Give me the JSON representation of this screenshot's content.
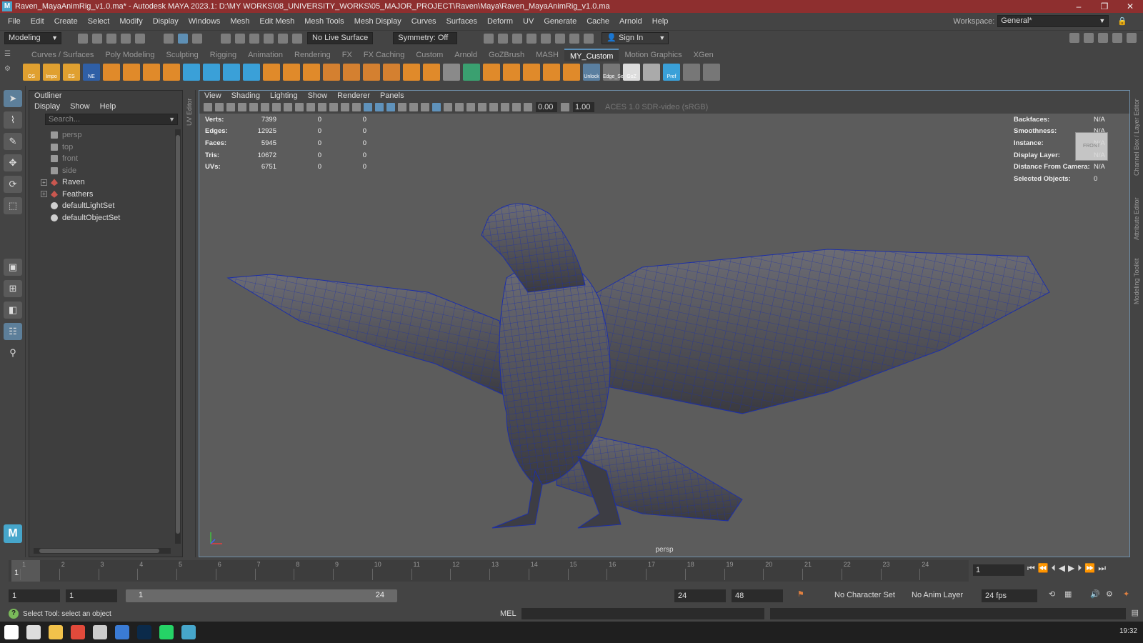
{
  "window": {
    "title": "Raven_MayaAnimRig_v1.0.ma* - Autodesk MAYA 2023.1: D:\\MY WORKS\\08_UNIVERSITY_WORKS\\05_MAJOR_PROJECT\\Raven\\Maya\\Raven_MayaAnimRig_v1.0.ma",
    "controls": [
      "–",
      "❐",
      "✕"
    ]
  },
  "menubar": {
    "items": [
      "File",
      "Edit",
      "Create",
      "Select",
      "Modify",
      "Display",
      "Windows",
      "Mesh",
      "Edit Mesh",
      "Mesh Tools",
      "Mesh Display",
      "Curves",
      "Surfaces",
      "Deform",
      "UV",
      "Generate",
      "Cache",
      "Arnold",
      "Help"
    ],
    "workspace_label": "Workspace:",
    "workspace_value": "General*"
  },
  "statusline": {
    "mode": "Modeling",
    "live_surface": "No Live Surface",
    "symmetry": "Symmetry: Off",
    "sign_in": "Sign In"
  },
  "shelf": {
    "tabs": [
      "Curves / Surfaces",
      "Poly Modeling",
      "Sculpting",
      "Rigging",
      "Animation",
      "Rendering",
      "FX",
      "FX Caching",
      "Custom",
      "Arnold",
      "GoZBrush",
      "MASH",
      "MY_Custom",
      "Motion Graphics",
      "XGen"
    ],
    "active_tab": "MY_Custom",
    "buttons": [
      {
        "label": "OS",
        "color": "#e0a030"
      },
      {
        "label": "Impo",
        "color": "#e0a030"
      },
      {
        "label": "ES",
        "color": "#e0a030"
      },
      {
        "label": "NE",
        "color": "#2f5fa6"
      },
      {
        "label": "",
        "color": "#e08a2a"
      },
      {
        "label": "",
        "color": "#e08a2a"
      },
      {
        "label": "",
        "color": "#e08a2a"
      },
      {
        "label": "",
        "color": "#e08a2a"
      },
      {
        "label": "",
        "color": "#3aa0d8"
      },
      {
        "label": "",
        "color": "#3aa0d8"
      },
      {
        "label": "",
        "color": "#3aa0d8"
      },
      {
        "label": "",
        "color": "#3aa0d8"
      },
      {
        "label": "",
        "color": "#e08a2a"
      },
      {
        "label": "",
        "color": "#e08a2a"
      },
      {
        "label": "",
        "color": "#e08a2a"
      },
      {
        "label": "",
        "color": "#d48030"
      },
      {
        "label": "",
        "color": "#d48030"
      },
      {
        "label": "",
        "color": "#d48030"
      },
      {
        "label": "",
        "color": "#d48030"
      },
      {
        "label": "",
        "color": "#e08a2a"
      },
      {
        "label": "",
        "color": "#e08a2a"
      },
      {
        "label": "",
        "color": "#8a8a8a"
      },
      {
        "label": "",
        "color": "#3aa070"
      },
      {
        "label": "",
        "color": "#e08a2a"
      },
      {
        "label": "",
        "color": "#e08a2a"
      },
      {
        "label": "",
        "color": "#e08a2a"
      },
      {
        "label": "",
        "color": "#e08a2a"
      },
      {
        "label": "",
        "color": "#e08a2a"
      },
      {
        "label": "Unlock",
        "color": "#5a7fa0"
      },
      {
        "label": "Edge_Se",
        "color": "#777"
      },
      {
        "label": "GoZ",
        "color": "#ddd"
      },
      {
        "label": "",
        "color": "#aaa"
      },
      {
        "label": "Pref",
        "color": "#3aa0d8"
      },
      {
        "label": "",
        "color": "#777"
      },
      {
        "label": "",
        "color": "#777"
      }
    ]
  },
  "outliner": {
    "title": "Outliner",
    "menu": [
      "Display",
      "Show",
      "Help"
    ],
    "search_placeholder": "Search...",
    "items": [
      {
        "name": "persp",
        "type": "camera"
      },
      {
        "name": "top",
        "type": "camera"
      },
      {
        "name": "front",
        "type": "camera"
      },
      {
        "name": "side",
        "type": "camera"
      },
      {
        "name": "Raven",
        "type": "group"
      },
      {
        "name": "Feathers",
        "type": "group"
      },
      {
        "name": "defaultLightSet",
        "type": "set"
      },
      {
        "name": "defaultObjectSet",
        "type": "set"
      }
    ]
  },
  "uv_editor_label": "UV Editor",
  "viewport": {
    "menu": [
      "View",
      "Shading",
      "Lighting",
      "Show",
      "Renderer",
      "Panels"
    ],
    "exposure": "0.00",
    "gamma": "1.00",
    "color_space": "ACES 1.0 SDR-video (sRGB)",
    "camera": "persp",
    "viewcube_face": "FRONT",
    "hud_left": [
      {
        "label": "Verts:",
        "value": "7399",
        "a": "0",
        "b": "0"
      },
      {
        "label": "Edges:",
        "value": "12925",
        "a": "0",
        "b": "0"
      },
      {
        "label": "Faces:",
        "value": "5945",
        "a": "0",
        "b": "0"
      },
      {
        "label": "Tris:",
        "value": "10672",
        "a": "0",
        "b": "0"
      },
      {
        "label": "UVs:",
        "value": "6751",
        "a": "0",
        "b": "0"
      }
    ],
    "hud_right": [
      {
        "label": "Backfaces:",
        "value": "N/A"
      },
      {
        "label": "Smoothness:",
        "value": "N/A"
      },
      {
        "label": "Instance:",
        "value": "N/A"
      },
      {
        "label": "Display Layer:",
        "value": "N/A"
      },
      {
        "label": "Distance From Camera:",
        "value": "N/A"
      },
      {
        "label": "Selected Objects:",
        "value": "0"
      }
    ]
  },
  "right_strip": [
    "Channel Box / Layer Editor",
    "Attribute Editor",
    "Modeling Toolkit"
  ],
  "timeline": {
    "frames": [
      "1",
      "2",
      "3",
      "4",
      "5",
      "6",
      "7",
      "8",
      "9",
      "10",
      "11",
      "12",
      "13",
      "14",
      "15",
      "16",
      "17",
      "18",
      "19",
      "20",
      "21",
      "22",
      "23",
      "24"
    ],
    "current_frame": "1"
  },
  "range": {
    "start": "1",
    "anim_start": "1",
    "slider_start": "1",
    "slider_end": "24",
    "end": "24",
    "anim_end": "48",
    "character_set": "No Character Set",
    "anim_layer": "No Anim Layer",
    "fps": "24 fps"
  },
  "commandline": {
    "help_text": "Select Tool: select an object",
    "lang": "MEL"
  },
  "taskbar": {
    "clock": "19:32",
    "apps": [
      {
        "name": "windows-start-icon",
        "color": "#ffffff"
      },
      {
        "name": "task-view-icon",
        "color": "#dddddd"
      },
      {
        "name": "file-explorer-icon",
        "color": "#f2c24b"
      },
      {
        "name": "chrome-icon",
        "color": "#e24a3b"
      },
      {
        "name": "steam-icon",
        "color": "#cccccc"
      },
      {
        "name": "app-icon",
        "color": "#3a7bd5"
      },
      {
        "name": "photoshop-icon",
        "color": "#0b2a4a"
      },
      {
        "name": "whatsapp-icon",
        "color": "#25d366"
      },
      {
        "name": "maya-icon",
        "color": "#46a6cb"
      }
    ]
  }
}
